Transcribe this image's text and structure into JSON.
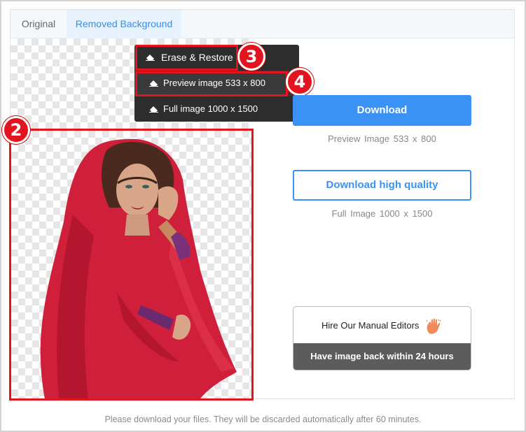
{
  "tabs": [
    {
      "label": "Original",
      "active": false
    },
    {
      "label": "Removed Background",
      "active": true
    }
  ],
  "menu": {
    "items": [
      {
        "label": "Erase & Restore",
        "icon": "eraser-icon"
      },
      {
        "label": "Preview image 533 x 800",
        "icon": "eraser-icon"
      },
      {
        "label": "Full image 1000 x 1500",
        "icon": "eraser-icon"
      }
    ]
  },
  "badges": {
    "image": "2",
    "erase": "3",
    "preview": "4"
  },
  "download": {
    "button_label": "Download",
    "preview_info": "Preview Image   533 x 800",
    "hq_button_label": "Download high quality",
    "full_info": "Full Image   1000 x 1500"
  },
  "hire": {
    "title": "Hire Our Manual Editors",
    "subtitle": "Have image back within 24 hours"
  },
  "footer_note": "Please download your files. They will be discarded automatically after 60 minutes.",
  "colors": {
    "accent": "#3b92f5",
    "highlight": "#e3141f",
    "menu_bg": "#2d2d2d"
  }
}
